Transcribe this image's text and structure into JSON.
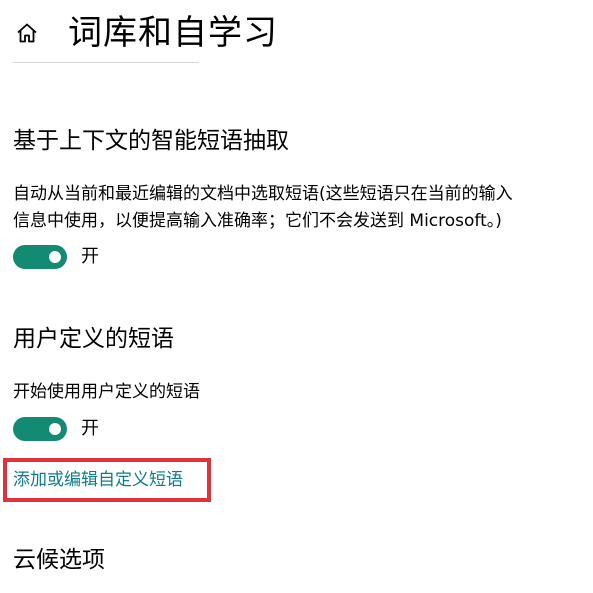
{
  "header": {
    "title": "词库和自学习",
    "home_icon": "home-icon"
  },
  "sections": {
    "contextual": {
      "heading": "基于上下文的智能短语抽取",
      "description_line1": "自动从当前和最近编辑的文档中选取短语(这些短语只在当前的输入",
      "description_line2": "信息中使用，以便提高输入准确率；它们不会发送到 Microsoft。)",
      "toggle_state": "开",
      "toggle_on": true
    },
    "user_defined": {
      "heading": "用户定义的短语",
      "description": "开始使用用户定义的短语",
      "toggle_state": "开",
      "toggle_on": true,
      "link": "添加或编辑自定义短语"
    },
    "cloud": {
      "heading": "云候选项"
    }
  },
  "colors": {
    "accent": "#138a72",
    "link": "#0f7b8a",
    "highlight": "#e0323a"
  }
}
